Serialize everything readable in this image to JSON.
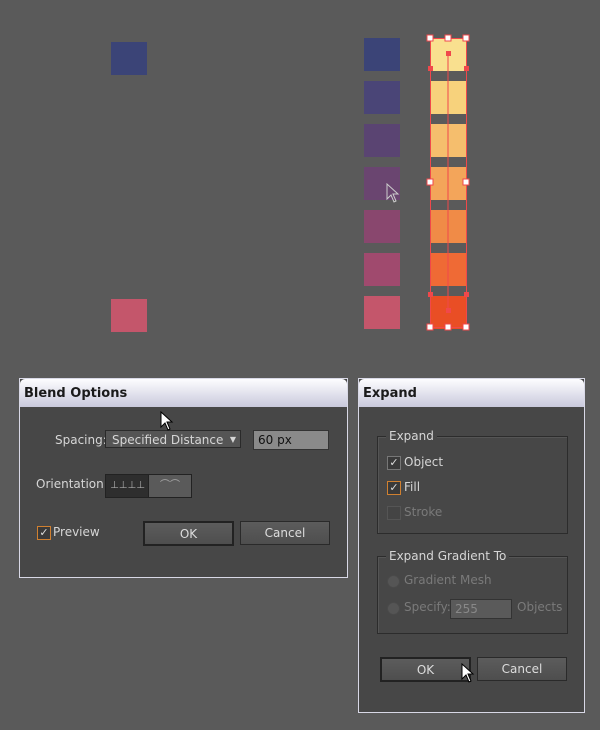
{
  "artboard": {
    "left_colors": [
      "#3b4477",
      "#4a4577",
      "#5a4472",
      "#6a4570",
      "#89476e",
      "#a04a6e",
      "#c4566b"
    ],
    "right_colors": [
      "#f9e08f",
      "#f7d27c",
      "#f5be6d",
      "#f3a55a",
      "#f08b47",
      "#ef6a35",
      "#e94e25"
    ],
    "single_top": "#3b4477",
    "single_bottom": "#c4566b",
    "selection_color": "#f0484b"
  },
  "blend": {
    "title": "Blend Options",
    "spacing_label": "Spacing:",
    "spacing_value": "Specified Distance",
    "distance": "60 px",
    "orientation_label": "Orientation:",
    "preview_label": "Preview",
    "preview_checked": true,
    "ok": "OK",
    "cancel": "Cancel"
  },
  "expand": {
    "title": "Expand",
    "group1": "Expand",
    "object": "Object",
    "fill": "Fill",
    "stroke": "Stroke",
    "group2": "Expand Gradient To",
    "mesh": "Gradient Mesh",
    "specify": "Specify:",
    "specify_value": "255",
    "objects": "Objects",
    "ok": "OK",
    "cancel": "Cancel"
  }
}
